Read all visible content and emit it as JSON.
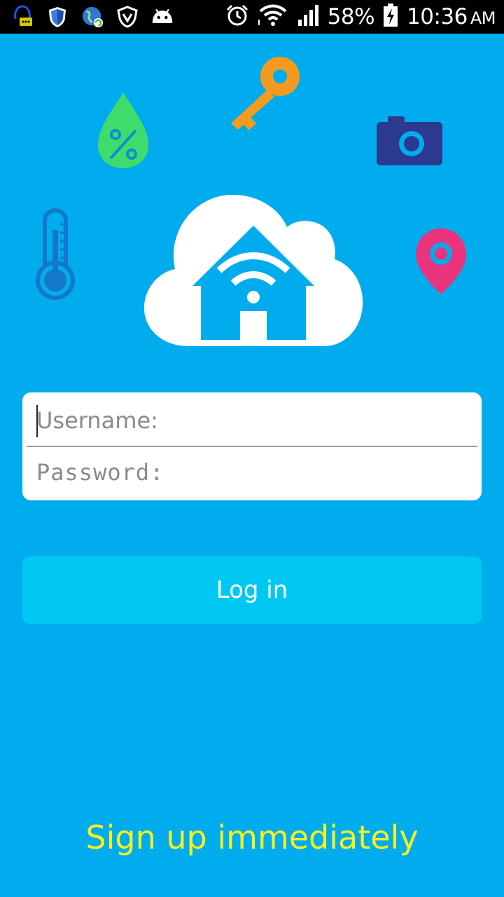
{
  "status_bar": {
    "battery": "58%",
    "time": "10:36",
    "ampm": "AM",
    "icons": [
      "assistant-chat-icon",
      "shield-icon",
      "globe-sync-icon",
      "vpn-shield-icon",
      "android-icon",
      "alarm-icon",
      "wifi-icon",
      "signal-icon",
      "battery-charging-icon"
    ]
  },
  "illustration": {
    "icons": [
      "humidity-drop-icon",
      "key-icon",
      "camera-icon",
      "thermometer-icon",
      "location-pin-icon",
      "cloud-home-wifi-icon"
    ],
    "colors": {
      "background": "#00aced",
      "humidity": "#3ddc6d",
      "key": "#f39a1f",
      "camera": "#2b3a8f",
      "thermometer": "#1478c8",
      "pin": "#e9337c",
      "cloud": "#ffffff"
    }
  },
  "login_form": {
    "username_placeholder": "Username:",
    "password_placeholder": "Password:",
    "login_label": "Log in"
  },
  "signup": {
    "label": "Sign up immediately",
    "color": "#f6f21d"
  }
}
